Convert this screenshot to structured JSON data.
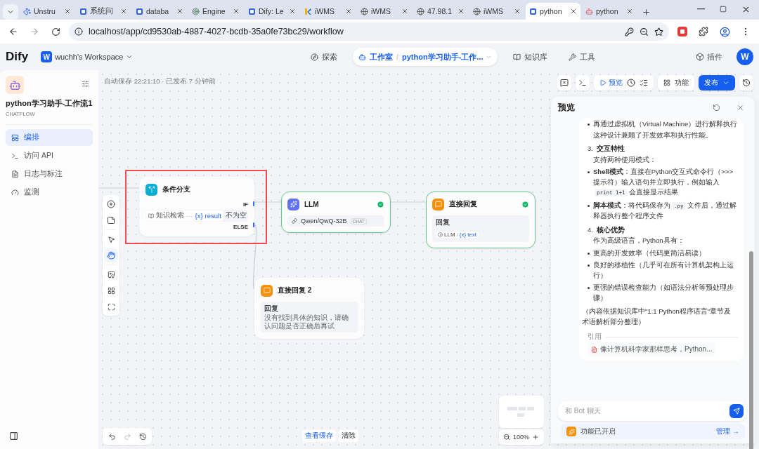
{
  "browser": {
    "tabs": [
      {
        "label": "Unstru",
        "kind": "paw",
        "selected": false
      },
      {
        "label": "系统问",
        "kind": "dify",
        "selected": false
      },
      {
        "label": "databa",
        "kind": "dify",
        "selected": false
      },
      {
        "label": "Engine",
        "kind": "target",
        "selected": false
      },
      {
        "label": "Dify: Le",
        "kind": "dify",
        "selected": false
      },
      {
        "label": "iWMS",
        "kind": "k",
        "selected": false
      },
      {
        "label": "iWMS",
        "kind": "globe",
        "selected": false
      },
      {
        "label": "47.98.1",
        "kind": "globe",
        "selected": false
      },
      {
        "label": "iWMS",
        "kind": "globe",
        "selected": false
      },
      {
        "label": "python",
        "kind": "dify",
        "selected": true
      },
      {
        "label": "python",
        "kind": "robot",
        "selected": false
      }
    ],
    "url": "localhost/app/cd9530ab-4887-4027-bcdb-35a0fe73bc29/workflow"
  },
  "header": {
    "logo": "Dify",
    "workspace_badge": "W",
    "workspace": "wuchh's Workspace",
    "nav": [
      {
        "label": "探索",
        "selected": false
      },
      {
        "label": "工作室",
        "selected": true,
        "separator": "/",
        "app": "python学习助手-工作..."
      },
      {
        "label": "知识库",
        "selected": false
      },
      {
        "label": "工具",
        "selected": false
      }
    ],
    "plugins": "插件",
    "avatar": "W"
  },
  "sidebar": {
    "app_name": "python学习助手-工作流1",
    "app_type": "CHATFLOW",
    "items": [
      {
        "label": "编排",
        "selected": true
      },
      {
        "label": "访问 API",
        "selected": false
      },
      {
        "label": "日志与标注",
        "selected": false
      },
      {
        "label": "监测",
        "selected": false
      }
    ]
  },
  "canvas": {
    "autosave": "自动保存 22:21:10 · 已发布 7 分钟前",
    "preview": "预览",
    "features": "功能",
    "publish": "发布",
    "nodes": [
      {
        "kind": "if_else",
        "title": "条件分支",
        "highlighted": true,
        "if_label": "IF",
        "else_label": "ELSE",
        "condition": {
          "source": "知识检索",
          "ellipsis": "···",
          "var_mark": "{x}",
          "variable": "result",
          "operator": "不为空"
        }
      },
      {
        "kind": "llm",
        "title": "LLM",
        "succeeded": true,
        "model": "Qwen/QwQ-32B",
        "mode": "CHAT"
      },
      {
        "kind": "answer",
        "title": "直接回复",
        "succeeded": true,
        "field_label": "回复",
        "ref": {
          "source": "LLM",
          "separator": "/",
          "var_mark": "{x}",
          "variable": "text"
        }
      },
      {
        "kind": "answer",
        "title": "直接回复 2",
        "succeeded": false,
        "field_label": "回复",
        "text": "没有找到具体的知识，请确认问题是否正确后再试"
      }
    ],
    "view_cache": "查看缓存",
    "clear": "清除",
    "zoom": "100%"
  },
  "preview": {
    "title": "预览",
    "blocks": [
      {
        "kind": "bullet",
        "segments": [
          {
            "kind": "text",
            "text": "再通过虚拟机（Virtual Machine）进行解释执行"
          }
        ]
      },
      {
        "kind": "indent",
        "segments": [
          {
            "kind": "text",
            "text": "这种设计兼顾了开发效率和执行性能。"
          }
        ]
      },
      {
        "kind": "heading",
        "number": "3.",
        "text": "交互特性"
      },
      {
        "kind": "indent",
        "segments": [
          {
            "kind": "text",
            "text": "支持两种使用模式："
          }
        ]
      },
      {
        "kind": "bullet",
        "segments": [
          {
            "kind": "bold",
            "text": "Shell模式"
          },
          {
            "kind": "text",
            "text": "：直接在Python交互式命令行（>>>提示符）输入语句并立即执行，例如输入"
          },
          {
            "kind": "code",
            "text": "print 1+1"
          },
          {
            "kind": "text",
            "text": "会直接显示结果"
          }
        ]
      },
      {
        "kind": "bullet",
        "segments": [
          {
            "kind": "bold",
            "text": "脚本模式"
          },
          {
            "kind": "text",
            "text": "：将代码保存为"
          },
          {
            "kind": "code",
            "text": ".py"
          },
          {
            "kind": "text",
            "text": "文件后，通过解释器执行整个程序文件"
          }
        ]
      },
      {
        "kind": "heading",
        "number": "4.",
        "text": "核心优势"
      },
      {
        "kind": "indent",
        "segments": [
          {
            "kind": "text",
            "text": "作为高级语言，Python具有："
          }
        ]
      },
      {
        "kind": "bullet",
        "segments": [
          {
            "kind": "text",
            "text": "更高的开发效率（代码更简洁易读）"
          }
        ]
      },
      {
        "kind": "bullet",
        "segments": [
          {
            "kind": "text",
            "text": "良好的移植性（几乎可在所有计算机架构上运行）"
          }
        ]
      },
      {
        "kind": "bullet",
        "segments": [
          {
            "kind": "text",
            "text": "更强的错误检查能力（如语法分析等预处理步骤）"
          }
        ]
      },
      {
        "kind": "paragraph",
        "segments": [
          {
            "kind": "text",
            "text": "（内容依据知识库中\"1.1 Python程序语言\"章节及术语解析部分整理）"
          }
        ]
      }
    ],
    "citation_label": "引用",
    "citation": "像计算机科学家那样思考，Python...",
    "input_placeholder": "和 Bot 聊天",
    "features_status": "功能已开启",
    "manage": "管理 →"
  }
}
